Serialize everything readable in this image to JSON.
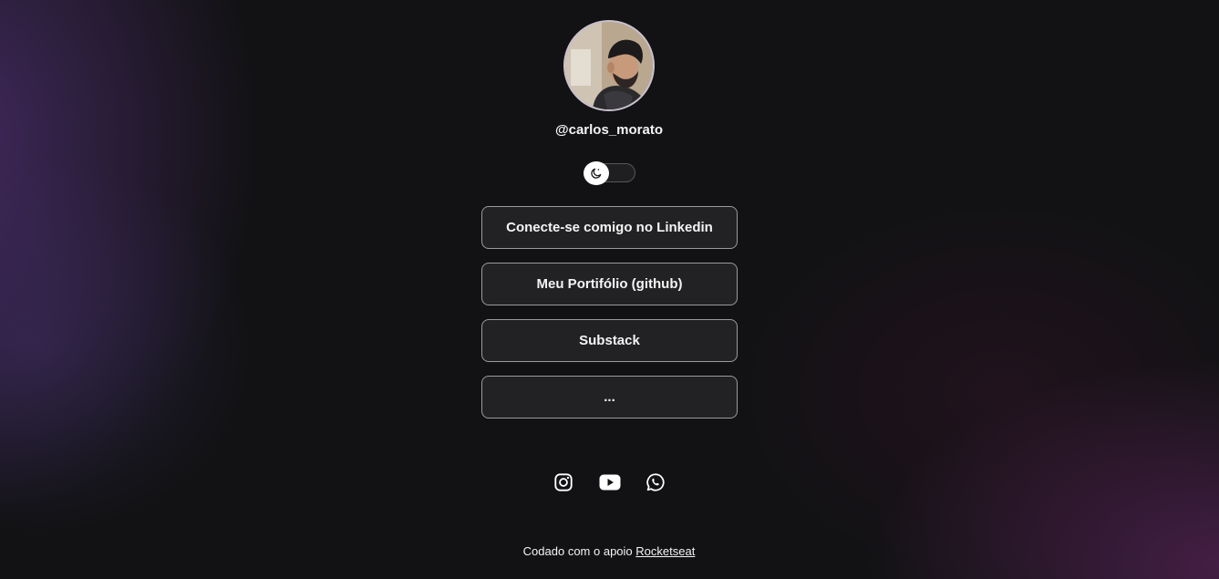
{
  "profile": {
    "username": "@carlos_morato",
    "avatar_icon": "profile-photo"
  },
  "theme_switch": {
    "icon": "moon-icon",
    "state": "dark"
  },
  "links": [
    {
      "label": "Conecte-se comigo no Linkedin"
    },
    {
      "label": "Meu Portifólio (github)"
    },
    {
      "label": "Substack"
    },
    {
      "label": "..."
    }
  ],
  "socials": [
    {
      "icon": "instagram-icon"
    },
    {
      "icon": "youtube-icon"
    },
    {
      "icon": "whatsapp-icon"
    }
  ],
  "footer": {
    "text": "Codado com o apoio",
    "link_label": "Rocketseat"
  },
  "colors": {
    "text": "#f4f4f5",
    "background": "#121214",
    "accent_purple": "#60378c"
  }
}
